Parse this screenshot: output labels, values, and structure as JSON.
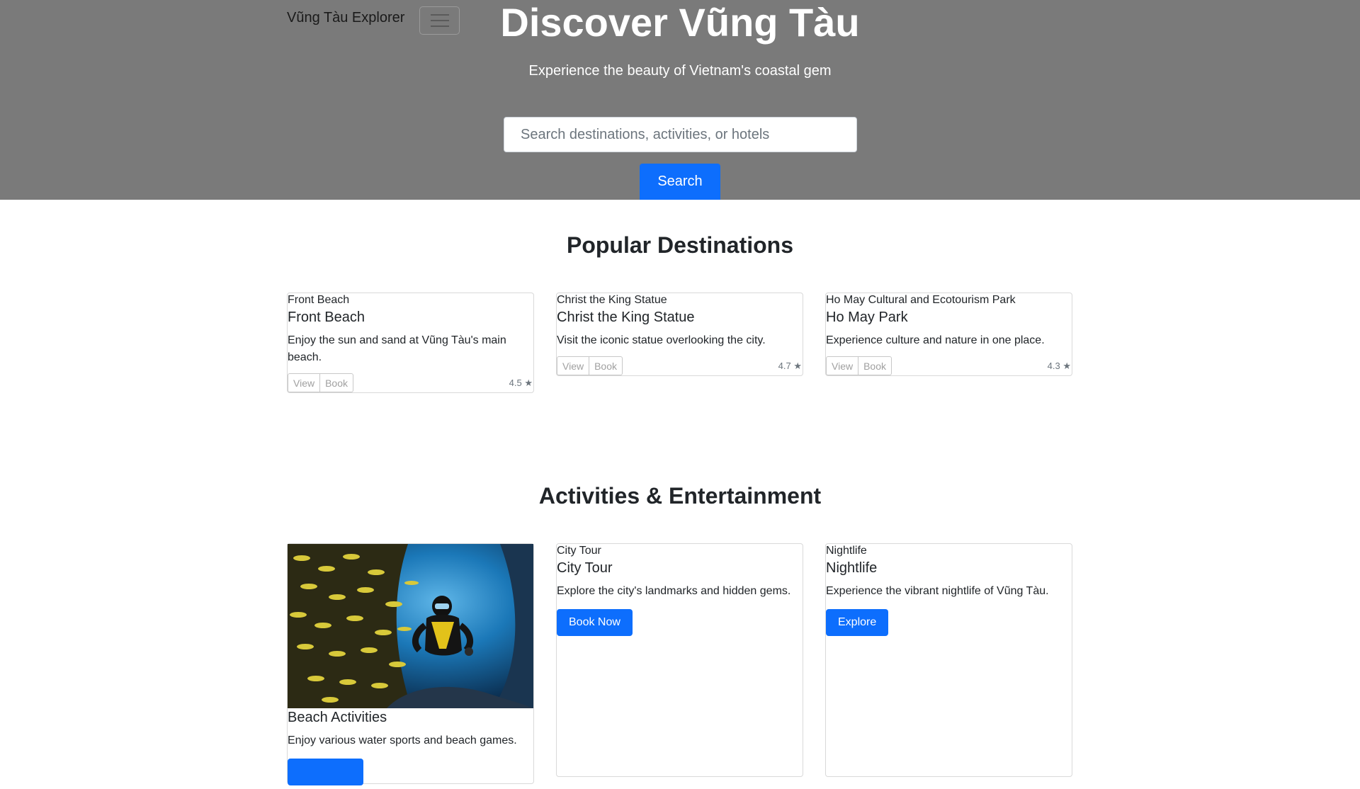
{
  "nav": {
    "brand": "Vũng Tàu Explorer"
  },
  "hero": {
    "title": "Discover Vũng Tàu",
    "subtitle": "Experience the beauty of Vietnam's coastal gem",
    "search_placeholder": "Search destinations, activities, or hotels",
    "search_button": "Search"
  },
  "destinations": {
    "heading": "Popular Destinations",
    "view_label": "View",
    "book_label": "Book",
    "items": [
      {
        "img_alt": "Front Beach",
        "title": "Front Beach",
        "text": "Enjoy the sun and sand at Vũng Tàu's main beach.",
        "rating": "4.5 ★"
      },
      {
        "img_alt": "Christ the King Statue",
        "title": "Christ the King Statue",
        "text": "Visit the iconic statue overlooking the city.",
        "rating": "4.7 ★"
      },
      {
        "img_alt": "Ho May Cultural and Ecotourism Park",
        "title": "Ho May Park",
        "text": "Experience culture and nature in one place.",
        "rating": "4.3 ★"
      }
    ]
  },
  "activities": {
    "heading": "Activities & Entertainment",
    "items": [
      {
        "title": "Beach Activities",
        "text": "Enjoy various water sports and beach games.",
        "button": ""
      },
      {
        "img_alt": "City Tour",
        "title": "City Tour",
        "text": "Explore the city's landmarks and hidden gems.",
        "button": "Book Now"
      },
      {
        "img_alt": "Nightlife",
        "title": "Nightlife",
        "text": "Experience the vibrant nightlife of Vũng Tàu.",
        "button": "Explore"
      }
    ]
  },
  "colors": {
    "hero_bg": "#7a7a7a",
    "primary": "#0d6efd"
  },
  "icons": {
    "menu": "hamburger-menu-icon"
  }
}
